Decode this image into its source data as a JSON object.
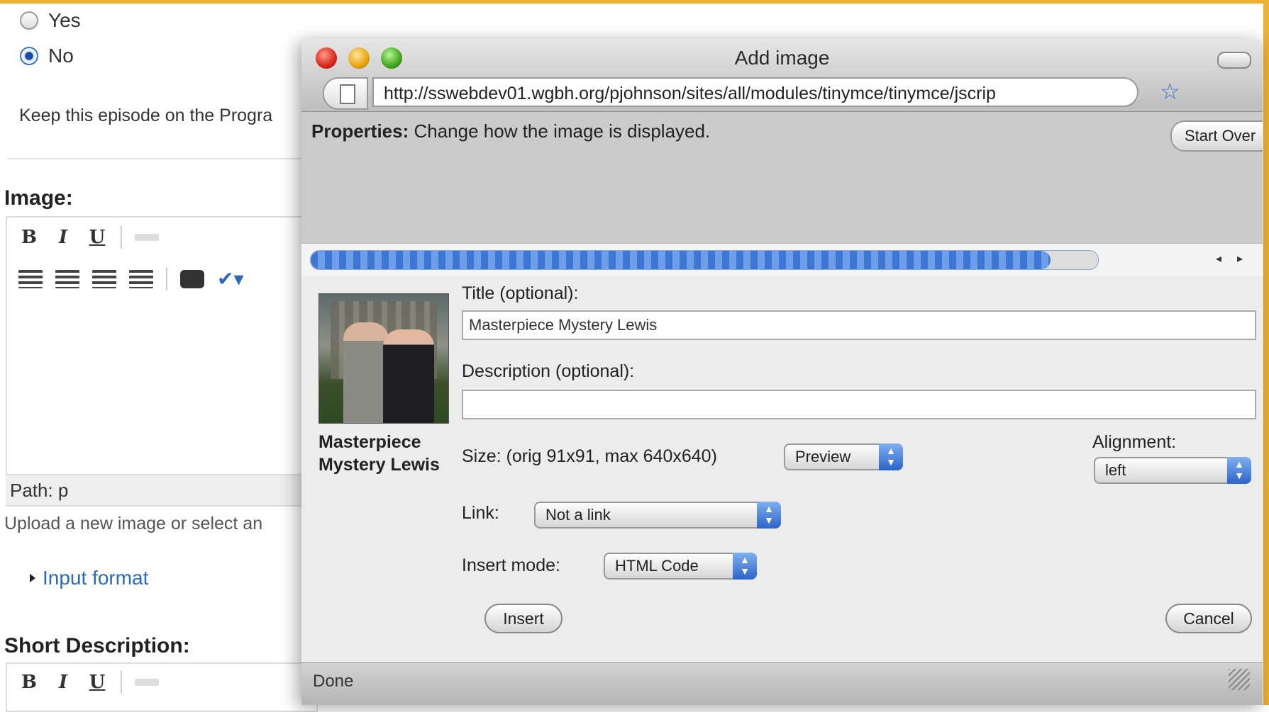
{
  "background_page": {
    "radio_yes": "Yes",
    "radio_no": "No",
    "selected_radio": "No",
    "keep_text": "Keep this episode on the Progra",
    "image_label": "Image:",
    "toolbar": {
      "bold": "B",
      "italic": "I",
      "underline": "U"
    },
    "path_label": "Path: p",
    "upload_text": "Upload a new image or select an",
    "input_format_link": "Input format",
    "short_description_label": "Short Description:"
  },
  "dialog": {
    "title": "Add image",
    "url": "http://sswebdev01.wgbh.org/pjohnson/sites/all/modules/tinymce/tinymce/jscrip",
    "properties_label": "Properties:",
    "properties_text": " Change how the image is displayed.",
    "start_over_button": "Start Over",
    "progress": 0.94,
    "thumbnail_caption": "Masterpiece Mystery Lewis",
    "title_label": "Title (optional):",
    "title_value": "Masterpiece Mystery Lewis",
    "description_label": "Description (optional):",
    "description_value": "",
    "size_label": "Size: (orig 91x91, max 640x640)",
    "size_select": "Preview",
    "alignment_label": "Alignment:",
    "alignment_select": "left",
    "link_label": "Link:",
    "link_select": "Not a link",
    "insert_mode_label": "Insert mode:",
    "insert_mode_select": "HTML Code",
    "insert_button": "Insert",
    "cancel_button": "Cancel",
    "status_text": "Done"
  },
  "colors": {
    "accent_bar": "#f0b030",
    "link_blue": "#2a6ab8",
    "progress_blue": "#3d77d4"
  }
}
